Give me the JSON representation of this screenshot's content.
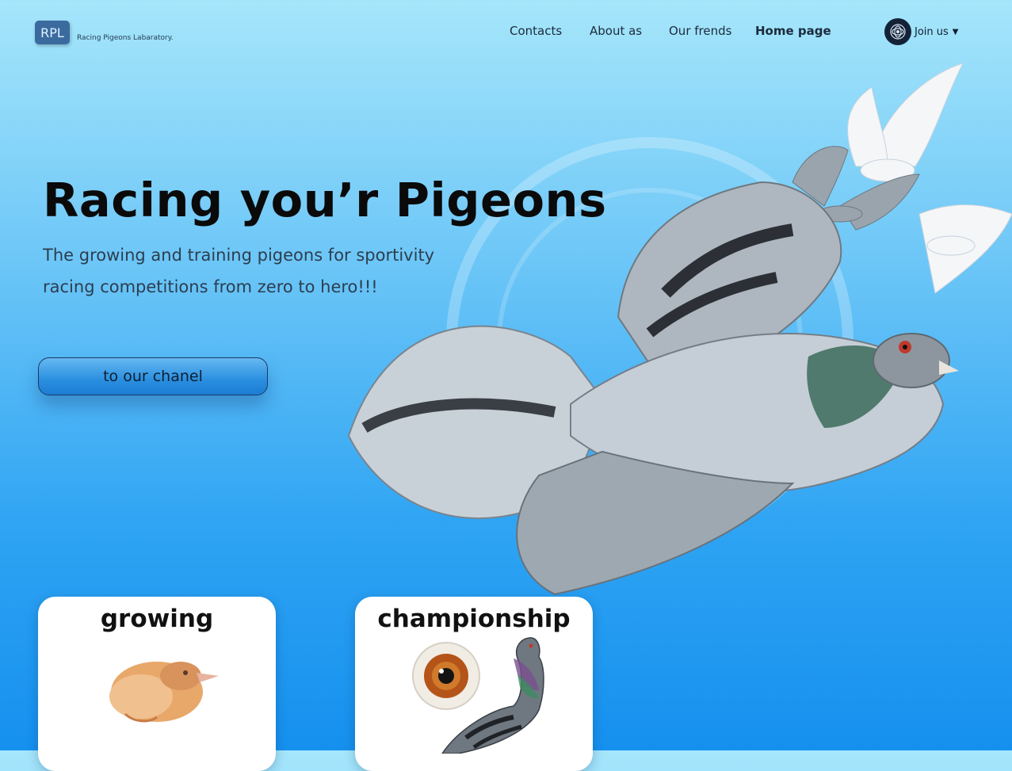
{
  "logo": {
    "mark": "RPL",
    "name": "Racing Pigeons Labaratory."
  },
  "nav": {
    "items": [
      {
        "label": "Contacts",
        "bold": false
      },
      {
        "label": "About as",
        "bold": false
      },
      {
        "label": "Our frends",
        "bold": false
      },
      {
        "label": "Home page",
        "bold": true
      }
    ]
  },
  "join": {
    "label": "Join us",
    "icon": "avatar-icon",
    "caret": "chevron-down-icon"
  },
  "hero": {
    "title": "Racing you’r Pigeons",
    "subtitle_line1": "The growing and training pigeons for sportivity",
    "subtitle_line2": "racing competitions from zero to hero!!!",
    "cta": "to our chanel"
  },
  "cards": [
    {
      "title": "growing",
      "image": "pigeon-chick-image"
    },
    {
      "title": "championship",
      "image": "racing-pigeon-image"
    }
  ],
  "colors": {
    "bg_top": "#a6e6fb",
    "bg_bottom": "#1590ee",
    "logo": "#3b6a9e",
    "cta": "#2a8fe0"
  }
}
